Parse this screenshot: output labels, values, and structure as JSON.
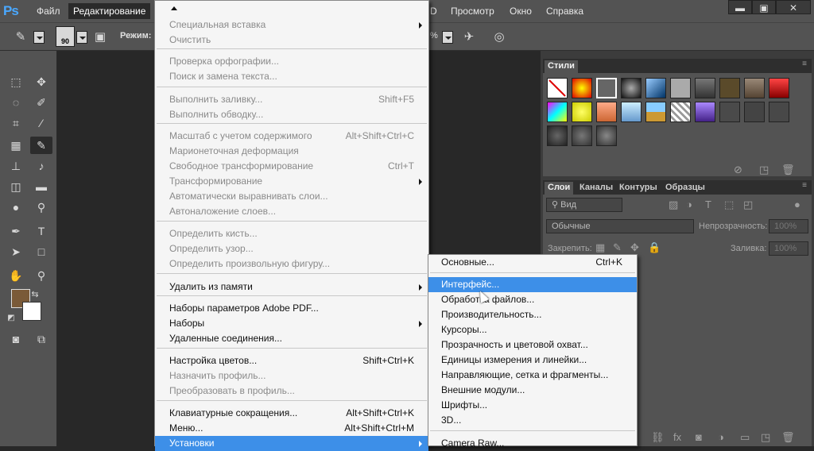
{
  "app": {
    "logo": "Ps"
  },
  "menubar": {
    "items": [
      "Файл",
      "Редактирование",
      "D",
      "Просмотр",
      "Окно",
      "Справка"
    ],
    "window_controls": [
      "▬",
      "▣",
      "✕"
    ]
  },
  "options": {
    "brush_size": "90",
    "mode_label": "Режим:",
    "percent_fragment": "%"
  },
  "edit_menu": {
    "rows": [
      {
        "label": "Специальная вставка",
        "shortcut": "",
        "disabled": true,
        "submenu": true
      },
      {
        "label": "Очистить",
        "shortcut": "",
        "disabled": true,
        "submenu": false
      },
      {
        "label": "Проверка орфографии...",
        "shortcut": "",
        "disabled": true,
        "submenu": false
      },
      {
        "label": "Поиск и замена текста...",
        "shortcut": "",
        "disabled": true,
        "submenu": false
      },
      {
        "label": "Выполнить заливку...",
        "shortcut": "Shift+F5",
        "disabled": true,
        "submenu": false
      },
      {
        "label": "Выполнить обводку...",
        "shortcut": "",
        "disabled": true,
        "submenu": false
      },
      {
        "label": "Масштаб с учетом содержимого",
        "shortcut": "Alt+Shift+Ctrl+C",
        "disabled": true,
        "submenu": false
      },
      {
        "label": "Марионеточная деформация",
        "shortcut": "",
        "disabled": true,
        "submenu": false
      },
      {
        "label": "Свободное трансформирование",
        "shortcut": "Ctrl+T",
        "disabled": true,
        "submenu": false
      },
      {
        "label": "Трансформирование",
        "shortcut": "",
        "disabled": true,
        "submenu": true
      },
      {
        "label": "Автоматически выравнивать слои...",
        "shortcut": "",
        "disabled": true,
        "submenu": false
      },
      {
        "label": "Автоналожение слоев...",
        "shortcut": "",
        "disabled": true,
        "submenu": false
      },
      {
        "label": "Определить кисть...",
        "shortcut": "",
        "disabled": true,
        "submenu": false
      },
      {
        "label": "Определить узор...",
        "shortcut": "",
        "disabled": true,
        "submenu": false
      },
      {
        "label": "Определить произвольную фигуру...",
        "shortcut": "",
        "disabled": true,
        "submenu": false
      },
      {
        "label": "Удалить из памяти",
        "shortcut": "",
        "disabled": false,
        "submenu": true
      },
      {
        "label": "Наборы параметров Adobe PDF...",
        "shortcut": "",
        "disabled": false,
        "submenu": false
      },
      {
        "label": "Наборы",
        "shortcut": "",
        "disabled": false,
        "submenu": true
      },
      {
        "label": "Удаленные соединения...",
        "shortcut": "",
        "disabled": false,
        "submenu": false
      },
      {
        "label": "Настройка цветов...",
        "shortcut": "Shift+Ctrl+K",
        "disabled": false,
        "submenu": false
      },
      {
        "label": "Назначить профиль...",
        "shortcut": "",
        "disabled": true,
        "submenu": false
      },
      {
        "label": "Преобразовать в профиль...",
        "shortcut": "",
        "disabled": true,
        "submenu": false
      },
      {
        "label": "Клавиатурные сокращения...",
        "shortcut": "Alt+Shift+Ctrl+K",
        "disabled": false,
        "submenu": false
      },
      {
        "label": "Меню...",
        "shortcut": "Alt+Shift+Ctrl+M",
        "disabled": false,
        "submenu": false
      },
      {
        "label": "Установки",
        "shortcut": "",
        "disabled": false,
        "submenu": true,
        "highlighted": true
      }
    ]
  },
  "preferences_submenu": {
    "rows": [
      {
        "label": "Основные...",
        "shortcut": "Ctrl+K"
      },
      {
        "label": "Интерфейс...",
        "shortcut": "",
        "highlighted": true
      },
      {
        "label": "Обработка файлов...",
        "shortcut": ""
      },
      {
        "label": "Производительность...",
        "shortcut": ""
      },
      {
        "label": "Курсоры...",
        "shortcut": ""
      },
      {
        "label": "Прозрачность и цветовой охват...",
        "shortcut": ""
      },
      {
        "label": "Единицы измерения и линейки...",
        "shortcut": ""
      },
      {
        "label": "Направляющие, сетка и фрагменты...",
        "shortcut": ""
      },
      {
        "label": "Внешние модули...",
        "shortcut": ""
      },
      {
        "label": "Шрифты...",
        "shortcut": ""
      },
      {
        "label": "3D...",
        "shortcut": ""
      },
      {
        "label": "Camera Raw...",
        "shortcut": ""
      }
    ]
  },
  "styles_panel": {
    "title": "Стили"
  },
  "layers_panel": {
    "tabs": [
      "Слои",
      "Каналы",
      "Контуры",
      "Образцы"
    ],
    "filter_label": "Вид",
    "blend_mode": "Обычные",
    "opacity_label": "Непрозрачность:",
    "opacity_value": "100%",
    "lock_label": "Закрепить:",
    "fill_label": "Заливка:",
    "fill_value": "100%"
  },
  "colors": {
    "accent": "#3d8fe8",
    "foreground_swatch": "#7a5a38",
    "background_swatch": "#ffffff"
  }
}
